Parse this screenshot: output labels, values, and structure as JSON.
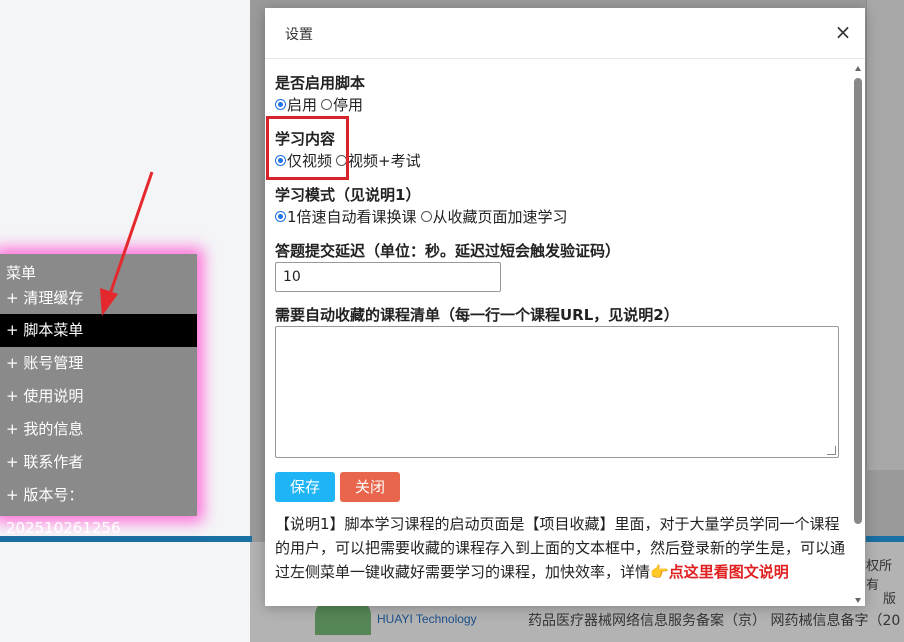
{
  "menu": {
    "title": "菜单",
    "items": [
      {
        "label": "+ 清理缓存"
      },
      {
        "label": "+ 脚本菜单"
      },
      {
        "label": "+ 账号管理"
      },
      {
        "label": "+ 使用说明"
      },
      {
        "label": "+ 我的信息"
      },
      {
        "label": "+ 联系作者"
      },
      {
        "label": "+ 版本号：202510261256"
      }
    ]
  },
  "modal": {
    "title": "设置",
    "close_icon": "×",
    "enable": {
      "label": "是否启用脚本",
      "options": [
        {
          "label": "启用",
          "checked": true
        },
        {
          "label": "停用",
          "checked": false
        }
      ]
    },
    "content": {
      "label": "学习内容",
      "options": [
        {
          "label": "仅视频",
          "checked": true
        },
        {
          "label": "视频+考试",
          "checked": false
        }
      ]
    },
    "mode": {
      "label": "学习模式（见说明1）",
      "options": [
        {
          "label": "1倍速自动看课换课",
          "checked": true
        },
        {
          "label": "从收藏页面加速学习",
          "checked": false
        }
      ]
    },
    "delay": {
      "label": "答题提交延迟（单位：秒。延迟过短会触发验证码）",
      "value": "10"
    },
    "course_list": {
      "label": "需要自动收藏的课程清单（每一行一个课程URL，见说明2）",
      "value": ""
    },
    "buttons": {
      "save": "保存",
      "close": "关闭"
    },
    "description": {
      "text": "【说明1】脚本学习课程的启动页面是【项目收藏】里面，对于大量学员学同一个课程的用户，可以把需要收藏的课程存入到上面的文本框中，然后登录新的学生是，可以通过左侧菜单一键收藏好需要学习的课程，加快效率，详情",
      "emoji": "👉",
      "link": "点这里看图文说明"
    }
  },
  "background": {
    "footer_text": "药品医疗器械网络信息服务备案（京） 网药械信息备字（20",
    "logo_text": "HUAYI Technology",
    "right_text_1": "权所有",
    "right_text_2": "版"
  }
}
